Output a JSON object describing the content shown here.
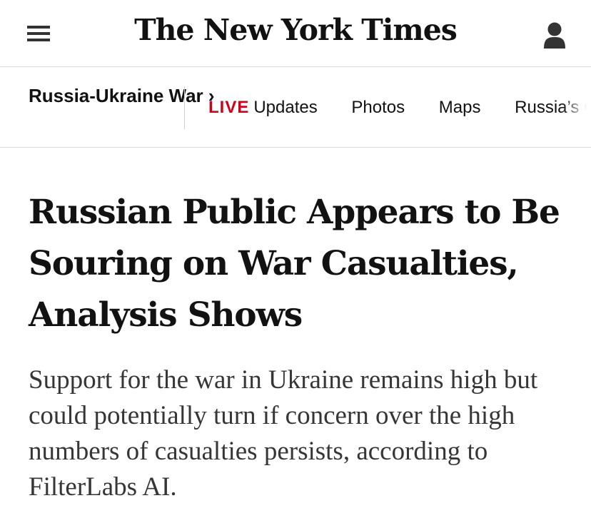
{
  "header": {
    "logo_text": "The New York Times",
    "menu_icon": "hamburger-menu-icon",
    "account_icon": "user-account-icon"
  },
  "subnav": {
    "section_title": "Russia-Ukraine War ›",
    "live_label": "LIVE",
    "links": [
      "Updates",
      "Photos",
      "Maps",
      "Russia’s C"
    ]
  },
  "article": {
    "headline": "Russian Public Appears to Be Souring on War Casualties, Analysis Shows",
    "summary": "Support for the war in Ukraine remains high but could potentially turn if concern over the high numbers of casualties persists, according to FilterLabs AI."
  },
  "colors": {
    "live": "#d0021b",
    "text": "#121212",
    "summary_text": "#363636",
    "divider": "#dcdcdc"
  }
}
